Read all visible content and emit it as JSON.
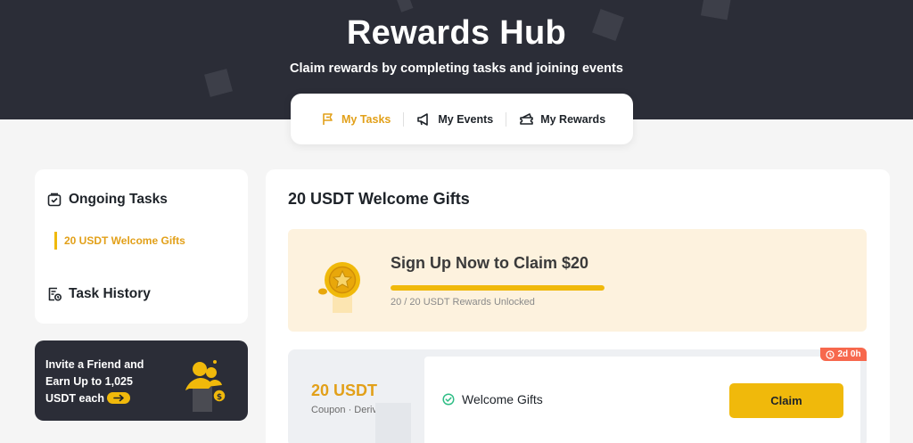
{
  "hero": {
    "title": "Rewards Hub",
    "subtitle": "Claim rewards by completing tasks and joining events"
  },
  "tabs": [
    {
      "label": "My Tasks",
      "icon": "flag-icon",
      "active": true
    },
    {
      "label": "My Events",
      "icon": "megaphone-icon",
      "active": false
    },
    {
      "label": "My Rewards",
      "icon": "ticket-icon",
      "active": false
    }
  ],
  "sidebar": {
    "ongoing_title": "Ongoing Tasks",
    "ongoing_items": [
      {
        "label": "20 USDT Welcome Gifts",
        "active": true
      }
    ],
    "history_title": "Task History"
  },
  "invite": {
    "line1": "Invite a Friend and",
    "line2": "Earn Up to 1,025",
    "line3": "USDT each"
  },
  "main": {
    "title": "20 USDT Welcome Gifts",
    "banner": {
      "title": "Sign Up Now to Claim $20",
      "progress_text": "20 / 20 USDT Rewards Unlocked",
      "progress_fraction": 1.0
    },
    "coupon": {
      "amount": "20 USDT",
      "type": "Coupon · Derivatives",
      "task_label": "Welcome Gifts",
      "claim_label": "Claim",
      "timer": "2d 0h"
    }
  },
  "colors": {
    "accent": "#f0b90b",
    "accent_text": "#e2a019",
    "dark": "#2b2d37",
    "timer": "#f7684d",
    "success": "#2ebd85"
  }
}
